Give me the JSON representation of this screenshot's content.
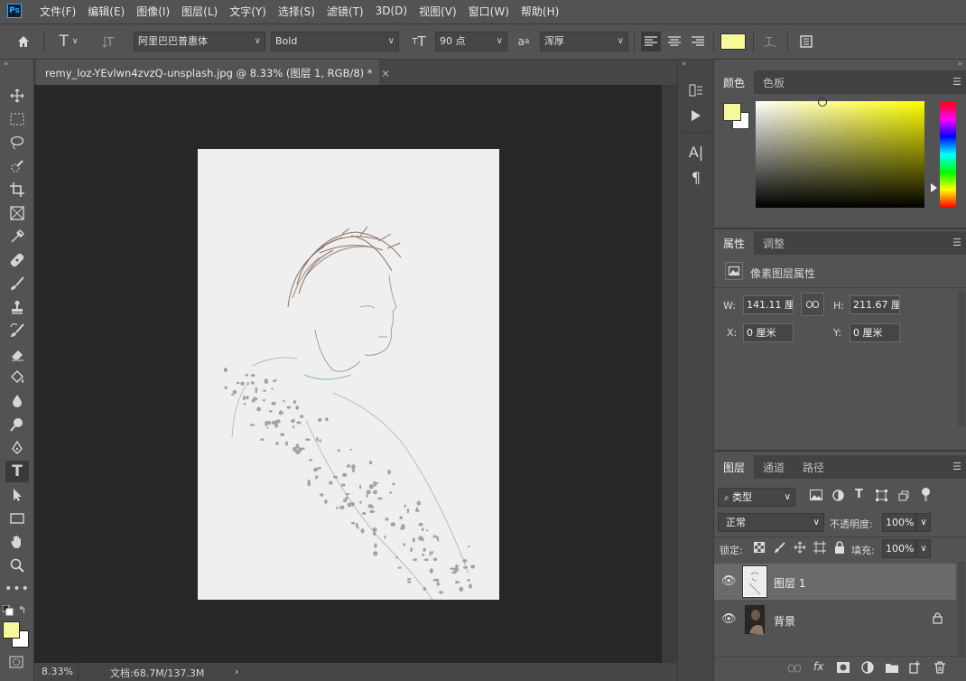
{
  "app": {
    "logo": "Ps"
  },
  "menu": [
    "文件(F)",
    "编辑(E)",
    "图像(I)",
    "图层(L)",
    "文字(Y)",
    "选择(S)",
    "滤镜(T)",
    "3D(D)",
    "视图(V)",
    "窗口(W)",
    "帮助(H)"
  ],
  "options": {
    "font_family": "阿里巴巴普惠体",
    "font_style": "Bold",
    "font_size": "90 点",
    "aa_icon_label": "a",
    "aa_sub": "a",
    "antialias": "浑厚",
    "text_color": "#f6f89a"
  },
  "document": {
    "tab_title": "remy_loz-YEvlwn4zvzQ-unsplash.jpg @ 8.33% (图层 1, RGB/8) *",
    "close": "×",
    "zoom": "8.33%",
    "doc_info": "文档:68.7M/137.3M",
    "status_arrow": "›"
  },
  "color_panel": {
    "tabs": [
      "颜色",
      "色板"
    ],
    "foreground": "#f6f89a",
    "background": "#ffffff",
    "hue_color": "#ffff00"
  },
  "properties_panel": {
    "tabs": [
      "属性",
      "调整"
    ],
    "title": "像素图层属性",
    "w_label": "W:",
    "w_value": "141.11 厘米",
    "h_label": "H:",
    "h_value": "211.67 厘米",
    "x_label": "X:",
    "x_value": "0 厘米",
    "y_label": "Y:",
    "y_value": "0 厘米"
  },
  "layers_panel": {
    "tabs": [
      "图层",
      "通道",
      "路径"
    ],
    "filter": "类型",
    "blend_mode": "正常",
    "opacity_label": "不透明度:",
    "opacity": "100%",
    "lock_label": "锁定:",
    "fill_label": "填充:",
    "fill": "100%",
    "layers": [
      {
        "name": "图层 1",
        "selected": true
      },
      {
        "name": "背景",
        "selected": false,
        "locked": true
      }
    ]
  },
  "tool_icons": [
    "move-icon",
    "marquee-icon",
    "lasso-icon",
    "quick-select-icon",
    "crop-icon",
    "frame-icon",
    "eyedropper-icon",
    "healing-icon",
    "brush-icon",
    "stamp-icon",
    "history-brush-icon",
    "eraser-icon",
    "bucket-icon",
    "blur-icon",
    "dodge-icon",
    "pen-icon",
    "type-icon",
    "path-select-icon",
    "rectangle-icon",
    "hand-icon",
    "zoom-icon",
    "more-icon"
  ]
}
